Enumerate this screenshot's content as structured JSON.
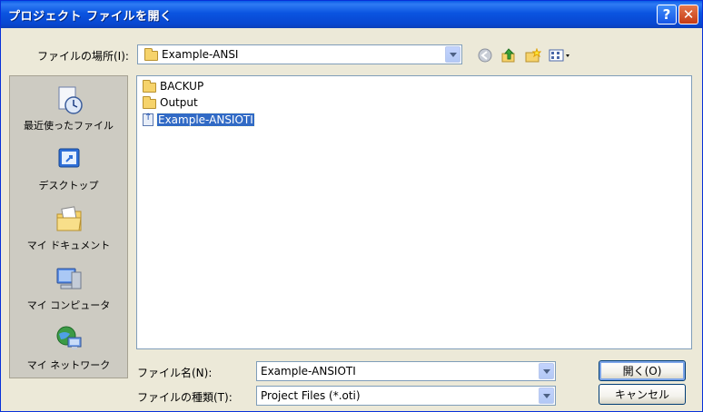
{
  "window": {
    "title": "プロジェクト ファイルを開く",
    "help_glyph": "?",
    "close_glyph": "✕"
  },
  "lookin": {
    "label": "ファイルの場所(I):",
    "value": "Example-ANSI"
  },
  "toolbar": {
    "back_icon": "back-icon",
    "up_icon": "up-folder-icon",
    "new_folder_icon": "new-folder-icon",
    "views_icon": "views-menu-icon"
  },
  "places": [
    {
      "label": "最近使ったファイル",
      "icon": "recent-documents-icon"
    },
    {
      "label": "デスクトップ",
      "icon": "desktop-icon"
    },
    {
      "label": "マイ ドキュメント",
      "icon": "my-documents-icon"
    },
    {
      "label": "マイ コンピュータ",
      "icon": "my-computer-icon"
    },
    {
      "label": "マイ ネットワーク",
      "icon": "my-network-icon"
    }
  ],
  "files": [
    {
      "name": "BACKUP",
      "type": "folder"
    },
    {
      "name": "Output",
      "type": "folder"
    },
    {
      "name": "Example-ANSIOTI",
      "type": "project",
      "selected": true
    }
  ],
  "filename": {
    "label": "ファイル名(N):",
    "value": "Example-ANSIOTI"
  },
  "filetype": {
    "label": "ファイルの種類(T):",
    "value": "Project Files (*.oti)"
  },
  "buttons": {
    "open": "開く(O)",
    "cancel": "キャンセル"
  },
  "colors": {
    "titlebar": "#0a54e0",
    "selection": "#316ac5",
    "dialog_bg": "#ece9d8"
  }
}
